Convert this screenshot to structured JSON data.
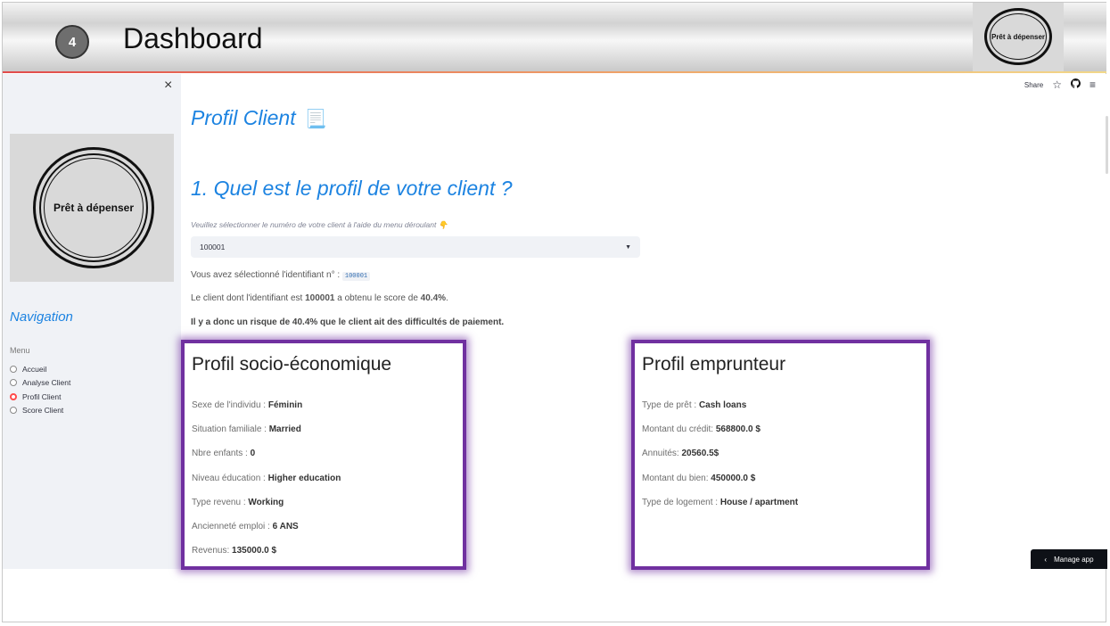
{
  "slide": {
    "number": "4",
    "title": "Dashboard",
    "logo_text": "Prêt à dépenser"
  },
  "sidebar": {
    "close_glyph": "×",
    "logo_text": "Prêt à dépenser",
    "nav_title": "Navigation",
    "menu_label": "Menu",
    "items": [
      {
        "label": "Accueil",
        "selected": false
      },
      {
        "label": "Analyse Client",
        "selected": false
      },
      {
        "label": "Profil Client",
        "selected": true
      },
      {
        "label": "Score Client",
        "selected": false
      }
    ]
  },
  "toolbar": {
    "share_label": "Share",
    "icons": [
      "star-icon",
      "github-icon",
      "hamburger-menu-icon"
    ]
  },
  "main": {
    "page_title": "Profil Client",
    "page_title_emoji": "📃",
    "question_title": "1. Quel est le profil de votre client ?",
    "hint": "Veuillez sélectionner le numéro de votre client à l'aide du menu déroulant 👇",
    "select_value": "100001",
    "selected_line_prefix": "Vous avez sélectionné l'identifiant n° : ",
    "selected_id_code": "100001",
    "score_line_prefix": "Le client dont l'identifiant est ",
    "score_client_id": "100001",
    "score_line_middle": " a obtenu le score de ",
    "score_value": "40.4%",
    "score_line_suffix": ".",
    "risk_line": "Il y a donc un risque de 40.4% que le client ait des difficultés de paiement."
  },
  "socio": {
    "title": "Profil socio-économique",
    "rows": [
      {
        "label": "Sexe de l'individu : ",
        "value": "Féminin"
      },
      {
        "label": "Situation familiale : ",
        "value": "Married"
      },
      {
        "label": "Nbre enfants : ",
        "value": "0"
      },
      {
        "label": "Niveau éducation : ",
        "value": "Higher education"
      },
      {
        "label": "Type revenu : ",
        "value": "Working"
      },
      {
        "label": "Ancienneté emploi : ",
        "value": "6 ANS"
      },
      {
        "label": "Revenus: ",
        "value": "135000.0 $"
      }
    ]
  },
  "borrower": {
    "title": "Profil emprunteur",
    "rows": [
      {
        "label": "Type de prêt : ",
        "value": "Cash loans"
      },
      {
        "label": "Montant du crédit: ",
        "value": "568800.0 $"
      },
      {
        "label": "Annuités: ",
        "value": "20560.5$"
      },
      {
        "label": "Montant du bien: ",
        "value": "450000.0 $"
      },
      {
        "label": "Type de logement : ",
        "value": "House / apartment"
      }
    ]
  },
  "manage_app": {
    "glyph": "‹",
    "label": "Manage app"
  },
  "colors": {
    "accent_blue": "#1c83e1",
    "highlight_purple": "#7030a0",
    "radio_selected": "#ff4b4b"
  }
}
